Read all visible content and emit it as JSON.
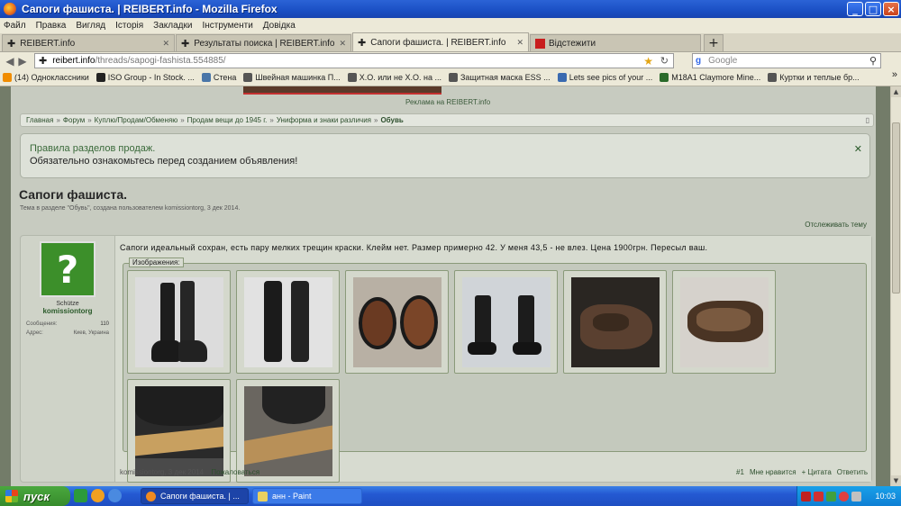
{
  "window": {
    "title": "Сапоги фашиста. | REIBERT.info - Mozilla Firefox"
  },
  "menu": [
    "Файл",
    "Правка",
    "Вигляд",
    "Історія",
    "Закладки",
    "Інструменти",
    "Довідка"
  ],
  "tabs": [
    {
      "label": "REIBERT.info"
    },
    {
      "label": "Результаты поиска | REIBERT.info"
    },
    {
      "label": "Сапоги фашиста. | REIBERT.info"
    },
    {
      "label": "Відстежити"
    }
  ],
  "nav": {
    "url_host": "reibert.info",
    "url_path": "/threads/sapogi-fashista.554885/",
    "search_placeholder": "Google"
  },
  "bookmarks": [
    {
      "label": "(14) Одноклассники",
      "color": "#f08c00"
    },
    {
      "label": "ISO Group - In Stock. ...",
      "color": "#222222"
    },
    {
      "label": "Стена",
      "color": "#4a76a8"
    },
    {
      "label": "Швейная машинка П...",
      "color": "#555555"
    },
    {
      "label": "Х.О. или не Х.О. на ...",
      "color": "#555555"
    },
    {
      "label": "Защитная маска ESS ...",
      "color": "#555555"
    },
    {
      "label": "Lets see pics of your ...",
      "color": "#3a6ab0"
    },
    {
      "label": "M18A1 Claymore Mine...",
      "color": "#2a6a2a"
    },
    {
      "label": "Куртки и теплые бр...",
      "color": "#555555"
    }
  ],
  "page": {
    "ad_label": "Реклама на REIBERT.info",
    "breadcrumb": [
      "Главная",
      "Форум",
      "Куплю/Продам/Обменяю",
      "Продам вещи до 1945 г.",
      "Униформа и знаки различия",
      "Обувь"
    ],
    "notice_title": "Правила разделов продаж.",
    "notice_text": "Обязательно ознакомьтесь перед созданием объявления!",
    "thread_title": "Сапоги фашиста.",
    "thread_meta": "Тема в разделе \"Обувь\", создана пользователем komissiontorg, 3 дек 2014.",
    "watch_label": "Отслеживать тему",
    "user": {
      "rank": "Schütze",
      "name": "komissiontorg",
      "messages_label": "Сообщения:",
      "messages_value": "110",
      "address_label": "Адрес:",
      "address_value": "Киев, Украина"
    },
    "message": "Сапоги идеальный сохран, есть пару мелких трещин краски. Клейм нет. Размер примерно 42. У меня 43,5 - не влез. Цена 1900грн. Пересыл ваш.",
    "attachments_label": "Изображения:",
    "footer": {
      "author_date": "komissiontorg, 3 дек 2014",
      "report": "Пожаловаться",
      "post_no": "#1",
      "like": "Мне нравится",
      "quote": "+ Цитата",
      "reply": "Ответить"
    }
  },
  "taskbar": {
    "start": "пуск",
    "tasks": [
      "Сапоги фашиста. | ...",
      "анн - Paint"
    ],
    "clock": "10:03"
  }
}
